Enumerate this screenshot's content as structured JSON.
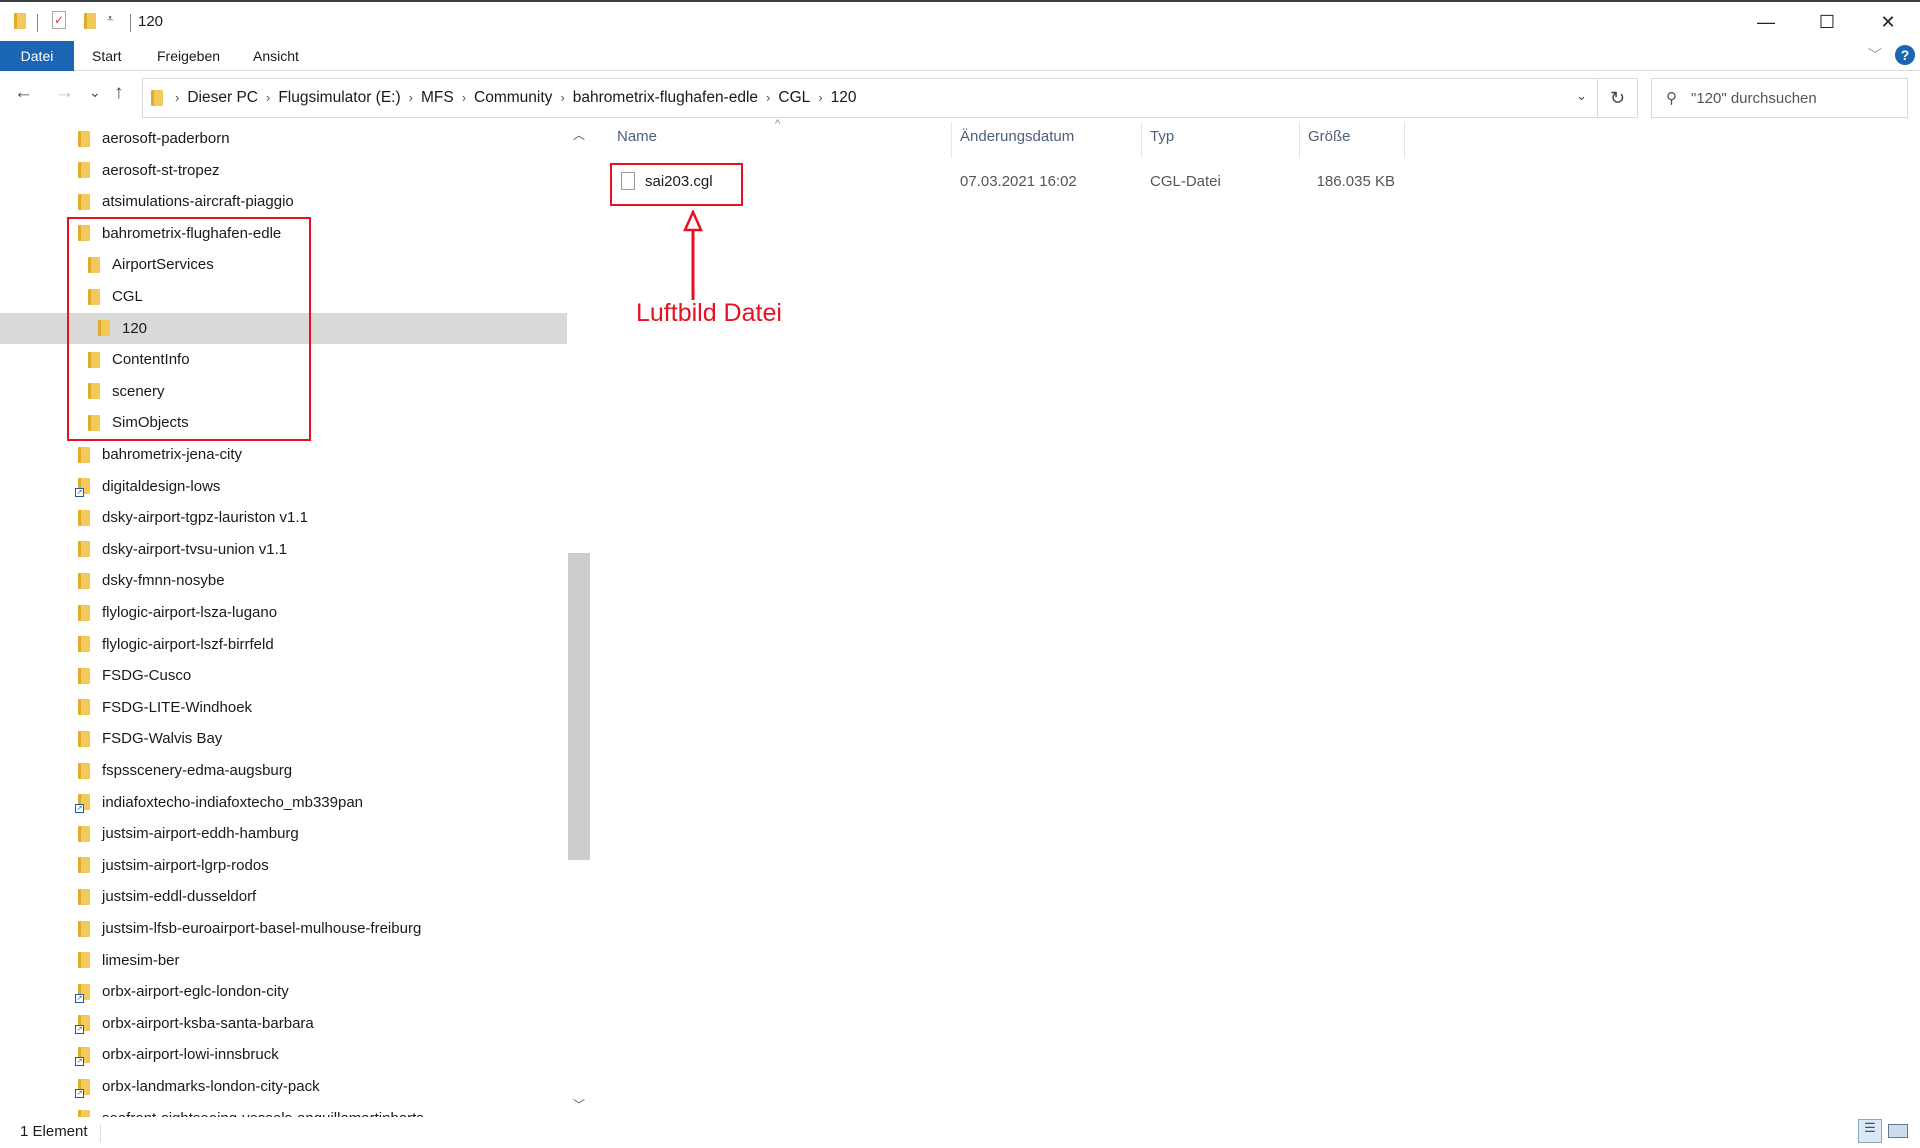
{
  "window": {
    "title": "120",
    "minimize": "—",
    "maximize": "☐",
    "close": "✕"
  },
  "ribbon": {
    "tabs": [
      "Datei",
      "Start",
      "Freigeben",
      "Ansicht"
    ],
    "help": "?"
  },
  "nav": {
    "back": "←",
    "forward": "→",
    "recent": "⌄",
    "up": "↑",
    "refresh": "↻",
    "breadcrumb": [
      "Dieser PC",
      "Flugsimulator (E:)",
      "MFS",
      "Community",
      "bahrometrix-flughafen-edle",
      "CGL",
      "120"
    ],
    "search_placeholder": "\"120\" durchsuchen"
  },
  "tree": {
    "items": [
      {
        "label": "aerosoft-paderborn",
        "level": 0
      },
      {
        "label": "aerosoft-st-tropez",
        "level": 0
      },
      {
        "label": "atsimulations-aircraft-piaggio",
        "level": 0
      },
      {
        "label": "bahrometrix-flughafen-edle",
        "level": 0
      },
      {
        "label": "AirportServices",
        "level": 1
      },
      {
        "label": "CGL",
        "level": 1
      },
      {
        "label": "120",
        "level": 2,
        "selected": true
      },
      {
        "label": "ContentInfo",
        "level": 1
      },
      {
        "label": "scenery",
        "level": 1
      },
      {
        "label": "SimObjects",
        "level": 1
      },
      {
        "label": "bahrometrix-jena-city",
        "level": 0
      },
      {
        "label": "digitaldesign-lows",
        "level": 0,
        "shortcut": true
      },
      {
        "label": "dsky-airport-tgpz-lauriston v1.1",
        "level": 0
      },
      {
        "label": "dsky-airport-tvsu-union v1.1",
        "level": 0
      },
      {
        "label": "dsky-fmnn-nosybe",
        "level": 0
      },
      {
        "label": "flylogic-airport-lsza-lugano",
        "level": 0
      },
      {
        "label": "flylogic-airport-lszf-birrfeld",
        "level": 0
      },
      {
        "label": "FSDG-Cusco",
        "level": 0
      },
      {
        "label": "FSDG-LITE-Windhoek",
        "level": 0
      },
      {
        "label": "FSDG-Walvis Bay",
        "level": 0
      },
      {
        "label": "fspsscenery-edma-augsburg",
        "level": 0
      },
      {
        "label": "indiafoxtecho-indiafoxtecho_mb339pan",
        "level": 0,
        "shortcut": true
      },
      {
        "label": "justsim-airport-eddh-hamburg",
        "level": 0
      },
      {
        "label": "justsim-airport-lgrp-rodos",
        "level": 0
      },
      {
        "label": "justsim-eddl-dusseldorf",
        "level": 0
      },
      {
        "label": "justsim-lfsb-euroairport-basel-mulhouse-freiburg",
        "level": 0
      },
      {
        "label": "limesim-ber",
        "level": 0
      },
      {
        "label": "orbx-airport-eglc-london-city",
        "level": 0,
        "shortcut": true
      },
      {
        "label": "orbx-airport-ksba-santa-barbara",
        "level": 0,
        "shortcut": true
      },
      {
        "label": "orbx-airport-lowi-innsbruck",
        "level": 0,
        "shortcut": true
      },
      {
        "label": "orbx-landmarks-london-city-pack",
        "level": 0,
        "shortcut": true
      },
      {
        "label": "seafront-sightseeing-vessels-anguillamartinbarts",
        "level": 0
      }
    ]
  },
  "columns": {
    "name": "Name",
    "date": "Änderungsdatum",
    "type": "Typ",
    "size": "Größe"
  },
  "files": [
    {
      "name": "sai203.cgl",
      "date": "07.03.2021 16:02",
      "type": "CGL-Datei",
      "size": "186.035 KB"
    }
  ],
  "annotation": {
    "label": "Luftbild Datei",
    "color": "#e81123"
  },
  "status": {
    "count": "1 Element"
  }
}
